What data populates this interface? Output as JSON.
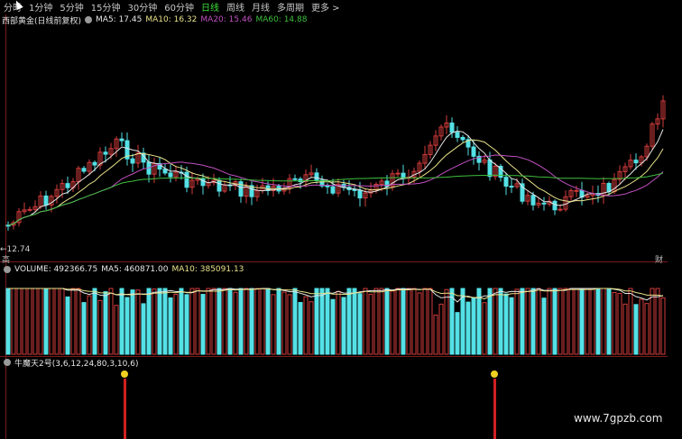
{
  "toolbar": {
    "items": [
      {
        "label": "分时"
      },
      {
        "label": "1分钟"
      },
      {
        "label": "5分钟"
      },
      {
        "label": "15分钟"
      },
      {
        "label": "30分钟"
      },
      {
        "label": "60分钟"
      },
      {
        "label": "日线"
      },
      {
        "label": "周线"
      },
      {
        "label": "月线"
      },
      {
        "label": "多周期"
      },
      {
        "label": "更多 >"
      }
    ],
    "active_index": 6
  },
  "price_panel": {
    "stock_name": "西部黄金(日线前复权)",
    "ma5": "MA5: 17.45",
    "ma10": "MA10: 16.32",
    "ma20": "MA20: 15.46",
    "ma60": "MA60: 14.88",
    "low_marker": "12.74",
    "bottom_left_mark": "高",
    "bottom_right_mark": "财"
  },
  "volume_panel": {
    "volume": "VOLUME: 492366.75",
    "ma5": "MA5: 460871.00",
    "ma10": "MA10: 385091.13"
  },
  "indicator_panel": {
    "title": "牛魔天2号(3,6,12,24,80,3,10,6)"
  },
  "watermark": {
    "text": "www.7gpzb.com"
  },
  "colors": {
    "up": "#d33b3b",
    "down": "#54e1e6",
    "ma5": "#e6e6e6",
    "ma10": "#e8e28a",
    "ma20": "#c050c0",
    "ma60": "#3fbf3f",
    "active_tab": "#3fdf3f"
  }
}
